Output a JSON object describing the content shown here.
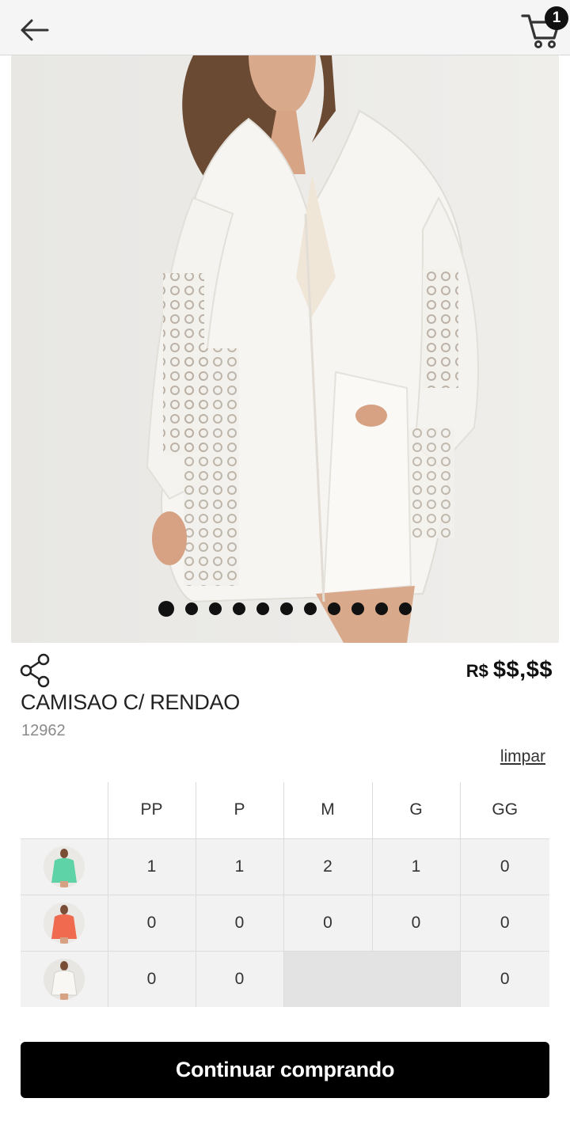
{
  "header": {
    "back_icon": "arrow-left-icon",
    "cart_icon": "shopping-cart-icon",
    "cart_count": "1"
  },
  "gallery": {
    "image_count": 11,
    "active_index": 0
  },
  "product": {
    "share_icon": "share-icon",
    "price_currency": "R$",
    "price_value": "$$,$$",
    "name": "CAMISAO C/ RENDAO",
    "code": "12962"
  },
  "grid": {
    "clear_label": "limpar",
    "sizes": [
      "PP",
      "P",
      "M",
      "G",
      "GG"
    ],
    "rows": [
      {
        "color_hex": "#5fd3a8",
        "quantities": [
          "1",
          "1",
          "2",
          "1",
          "0"
        ],
        "available": [
          true,
          true,
          true,
          true,
          true
        ]
      },
      {
        "color_hex": "#f06a4f",
        "quantities": [
          "0",
          "0",
          "0",
          "0",
          "0"
        ],
        "available": [
          true,
          true,
          true,
          true,
          true
        ]
      },
      {
        "color_hex": "#f1efe9",
        "quantities": [
          "0",
          "0",
          "",
          "",
          "0"
        ],
        "available": [
          true,
          true,
          false,
          false,
          true
        ]
      }
    ]
  },
  "actions": {
    "continue_label": "Continuar comprando"
  },
  "colors": {
    "button_bg": "#000000",
    "badge_bg": "#111111",
    "cell_bg": "#f2f2f2",
    "unavailable_bg": "#e3e3e3"
  }
}
